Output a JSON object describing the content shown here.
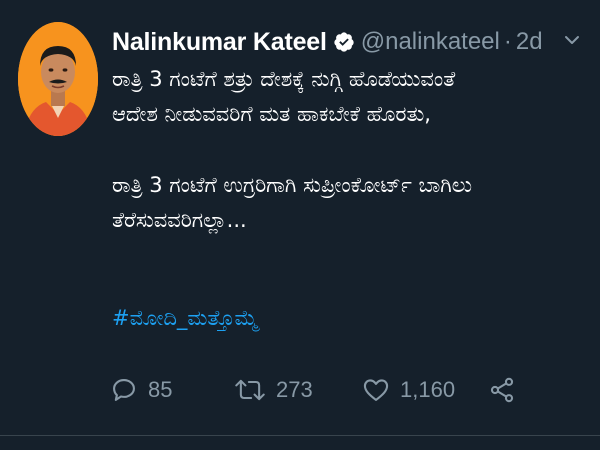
{
  "tweet": {
    "author_name": "Nalinkumar Kateel",
    "handle": "@nalinkateel",
    "separator": "·",
    "time": "2d",
    "lines_block1": [
      "ರಾತ್ರಿ 3 ಗಂಟೆಗೆ ಶತ್ರು ದೇಶಕ್ಕೆ ನುಗ್ಗಿ ಹೊಡೆಯುವಂತೆ",
      "ಆದೇಶ ನೀಡುವವರಿಗೆ ಮತ ಹಾಕಬೇಕೆ ಹೊರತು,"
    ],
    "lines_block2": [
      "ರಾತ್ರಿ 3 ಗಂಟೆಗೆ ಉಗ್ರರಿಗಾಗಿ ಸುಪ್ರೀಂಕೋರ್ಟ್ ಬಾಗಿಲು",
      "ತೆರೆಸುವವರಿಗಲ್ಲಾ..."
    ],
    "hashtag": "#ಮೋದಿ_ಮತ್ತೊಮ್ಮೆ",
    "replies": "85",
    "retweets": "273",
    "likes": "1,160"
  },
  "colors": {
    "background": "#15202b",
    "text": "#ffffff",
    "muted": "#8899a6",
    "link": "#1da1f2",
    "verified": "#ffffff",
    "avatar_bg": "#f7931e"
  },
  "icons": {
    "verified": "verified-badge-icon",
    "caret": "chevron-down-icon",
    "reply": "reply-icon",
    "retweet": "retweet-icon",
    "like": "heart-icon",
    "share": "share-icon"
  }
}
